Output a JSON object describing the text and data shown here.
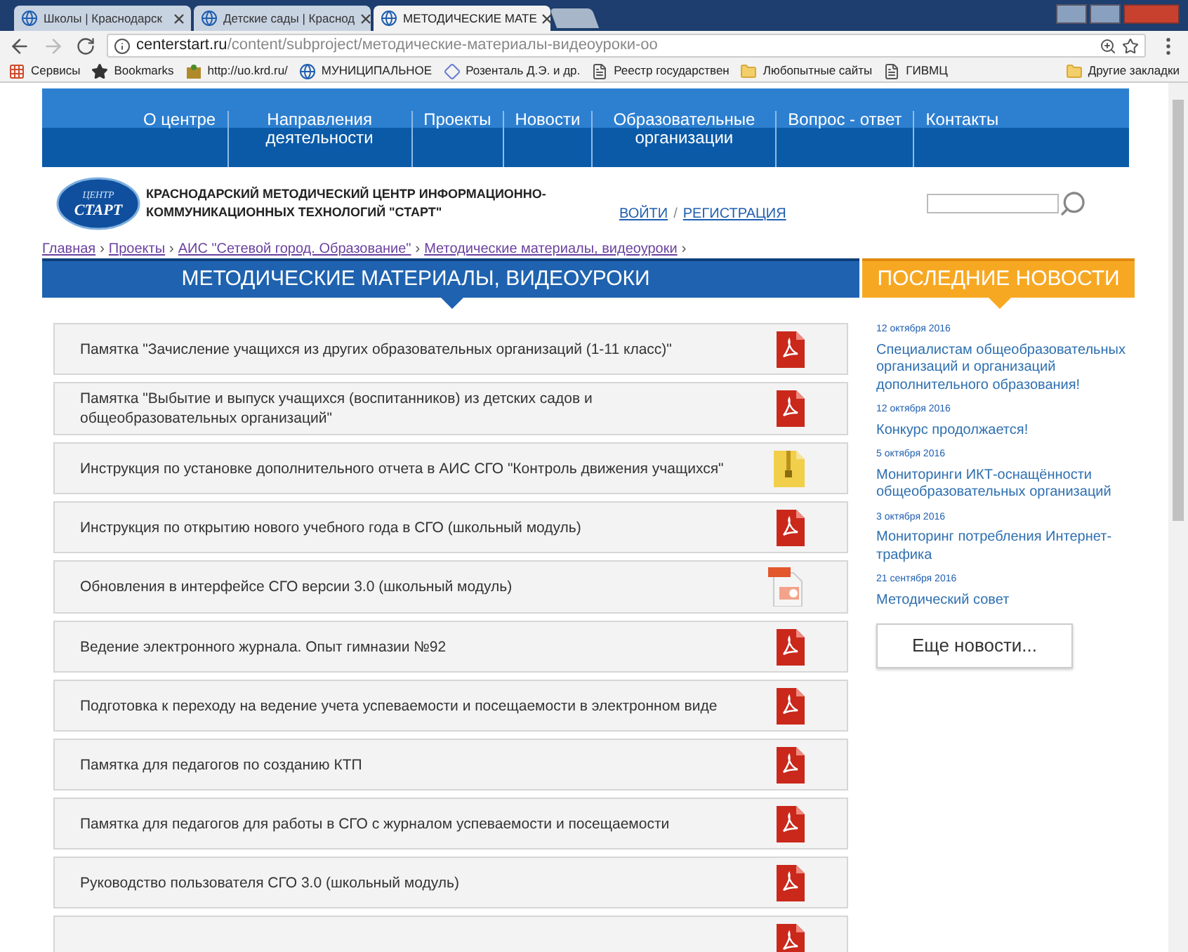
{
  "browser": {
    "tabs": [
      {
        "title": "Школы | Краснодарск",
        "selected": false
      },
      {
        "title": "Детские сады | Краснод",
        "selected": false
      },
      {
        "title": "МЕТОДИЧЕСКИЕ МАТЕ",
        "selected": true
      }
    ],
    "address": {
      "host": "centerstart.ru",
      "path": "/content/subproject/методические-материалы-видеоуроки-оо"
    },
    "bookmarks": [
      {
        "kind": "apps",
        "label": "Сервисы"
      },
      {
        "kind": "star",
        "label": "Bookmarks"
      },
      {
        "kind": "site",
        "label": "http://uo.krd.ru/"
      },
      {
        "kind": "globe",
        "label": "МУНИЦИПАЛЬНОЕ"
      },
      {
        "kind": "diamond",
        "label": "Розенталь Д.Э. и др."
      },
      {
        "kind": "page",
        "label": "Реестр государствен"
      },
      {
        "kind": "folder",
        "label": "Любопытные сайты"
      },
      {
        "kind": "page",
        "label": "ГИВМЦ"
      }
    ],
    "other_bookmarks": "Другие закладки"
  },
  "nav": [
    {
      "label": "О центре"
    },
    {
      "label": "Направления деятельности"
    },
    {
      "label": "Проекты"
    },
    {
      "label": "Новости"
    },
    {
      "label": "Образовательные организации"
    },
    {
      "label": "Вопрос - ответ"
    },
    {
      "label": "Контакты"
    }
  ],
  "header": {
    "logo_top": "ЦЕНТР",
    "logo_main": "СТАРТ",
    "org_name": "КРАСНОДАРСКИЙ МЕТОДИЧЕСКИЙ ЦЕНТР ИНФОРМАЦИОННО-КОММУНИКАЦИОННЫХ ТЕХНОЛОГИЙ \"СТАРТ\"",
    "login": "ВОЙТИ",
    "separator": "/",
    "register": "РЕГИСТРАЦИЯ"
  },
  "breadcrumbs": [
    "Главная",
    "Проекты",
    "АИС \"Сетевой город. Образование\"",
    "Методические материалы, видеоуроки"
  ],
  "breadcrumb_separator": "›",
  "main_title": "МЕТОДИЧЕСКИЕ МАТЕРИАЛЫ, ВИДЕОУРОКИ",
  "documents": [
    {
      "title": "Памятка \"Зачисление учащихся из других образовательных организаций (1-11 класс)\"",
      "kind": "pdf"
    },
    {
      "title": "Памятка \"Выбытие и выпуск учащихся (воспитанников) из детских садов и общеобразовательных организаций\"",
      "kind": "pdf"
    },
    {
      "title": "Инструкция по установке дополнительного отчета в АИС СГО \"Контроль движения учащихся\"",
      "kind": "zip"
    },
    {
      "title": "Инструкция по открытию нового учебного года  в СГО (школьный модуль)",
      "kind": "pdf"
    },
    {
      "title": "Обновления в интерфейсе СГО версии 3.0  (школьный модуль)",
      "kind": "ppt"
    },
    {
      "title": "Ведение электронного журнала. Опыт гимназии №92",
      "kind": "pdf"
    },
    {
      "title": "Подготовка к переходу на ведение учета успеваемости и посещаемости в электронном виде",
      "kind": "pdf"
    },
    {
      "title": "Памятка для педагогов по созданию КТП",
      "kind": "pdf"
    },
    {
      "title": "Памятка для педагогов для работы в СГО с журналом успеваемости и посещаемости",
      "kind": "pdf"
    },
    {
      "title": "Руководство пользователя СГО 3.0 (школьный модуль)",
      "kind": "pdf"
    },
    {
      "kind": "pdf"
    }
  ],
  "news": {
    "title": "ПОСЛЕДНИЕ НОВОСТИ",
    "items": [
      {
        "date": "12 октября 2016",
        "headline": "Специалистам общеобразовательных организаций и организаций дополнительного образования!"
      },
      {
        "date": "12 октября 2016",
        "headline": "Конкурс продолжается!"
      },
      {
        "date": "5 октября 2016",
        "headline": "Мониторинги ИКТ-оснащённости общеобразовательных организаций"
      },
      {
        "date": "3 октября 2016",
        "headline": "Мониторинг потребления Интернет-трафика"
      },
      {
        "date": "21 сентября 2016",
        "headline": "Методический совет"
      }
    ],
    "more_button": "Еще новости..."
  }
}
